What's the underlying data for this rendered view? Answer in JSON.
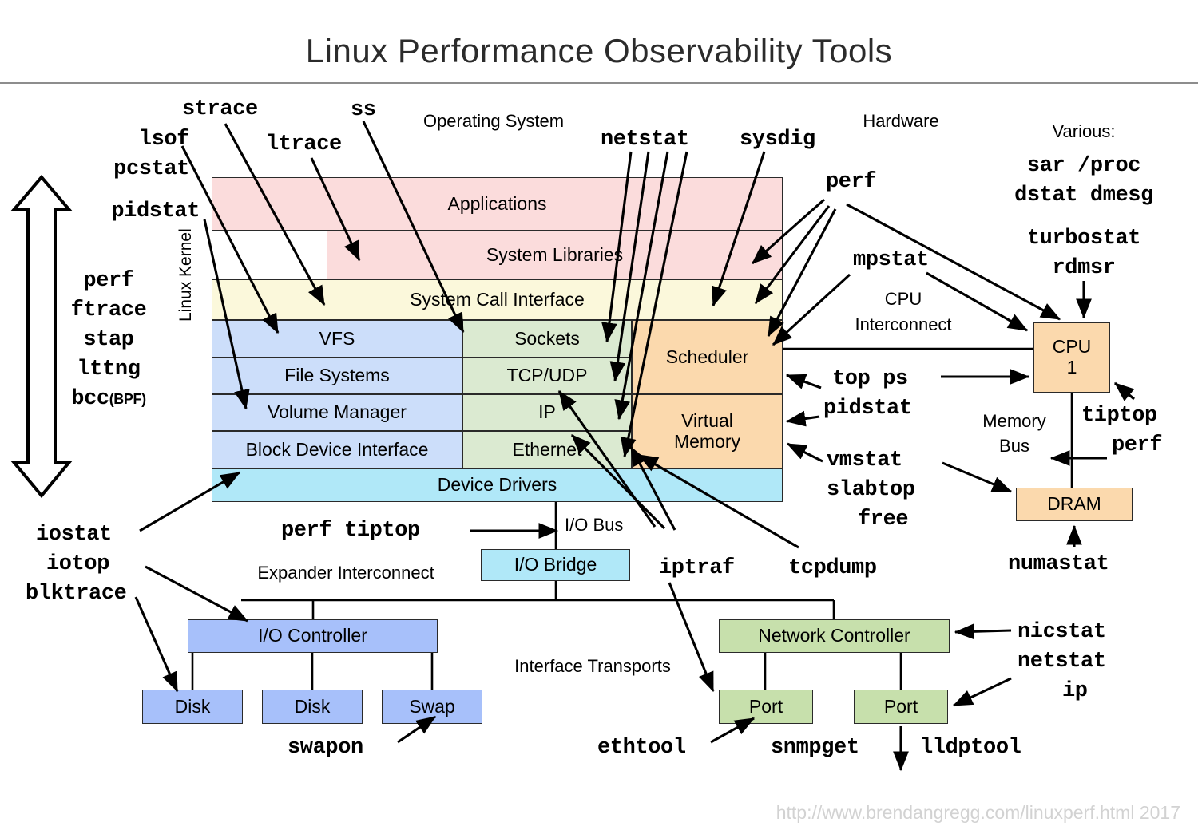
{
  "title": "Linux Performance Observability Tools",
  "footer": "http://www.brendangregg.com/linuxperf.html 2017",
  "section_labels": {
    "operating_system": "Operating System",
    "hardware": "Hardware",
    "various": "Various:",
    "linux_kernel": "Linux Kernel",
    "cpu_interconnect_l1": "CPU",
    "cpu_interconnect_l2": "Interconnect",
    "memory_bus_l1": "Memory",
    "memory_bus_l2": "Bus",
    "io_bus": "I/O Bus",
    "expander_interconnect": "Expander Interconnect",
    "interface_transports": "Interface Transports"
  },
  "stack": {
    "applications": "Applications",
    "system_libraries": "System Libraries",
    "system_call_interface": "System Call Interface",
    "vfs": "VFS",
    "file_systems": "File Systems",
    "volume_manager": "Volume Manager",
    "block_device_interface": "Block Device Interface",
    "sockets": "Sockets",
    "tcp_udp": "TCP/UDP",
    "ip": "IP",
    "ethernet": "Ethernet",
    "scheduler": "Scheduler",
    "virtual_memory_l1": "Virtual",
    "virtual_memory_l2": "Memory",
    "device_drivers": "Device Drivers"
  },
  "hardware": {
    "cpu_l1": "CPU",
    "cpu_l2": "1",
    "dram": "DRAM",
    "io_bridge": "I/O Bridge",
    "io_controller": "I/O Controller",
    "disk_1": "Disk",
    "disk_2": "Disk",
    "swap": "Swap",
    "network_controller": "Network Controller",
    "port_1": "Port",
    "port_2": "Port"
  },
  "tools": {
    "lsof": "lsof",
    "pcstat": "pcstat",
    "pidstat_left": "pidstat",
    "strace": "strace",
    "ltrace": "ltrace",
    "ss": "ss",
    "netstat_top": "netstat",
    "sysdig": "sysdig",
    "perf_hw": "perf",
    "mpstat": "mpstat",
    "sar_proc": "sar /proc",
    "dstat_dmesg": "dstat dmesg",
    "turbostat": "turbostat",
    "rdmsr": "rdmsr",
    "top_ps": "top ps",
    "pidstat_cpu": "pidstat",
    "tiptop": "tiptop",
    "perf_mem": "perf",
    "vmstat": "vmstat",
    "slabtop": "slabtop",
    "free": "free",
    "numastat": "numastat",
    "perf_stack": "perf",
    "ftrace": "ftrace",
    "stap": "stap",
    "lttng": "lttng",
    "bcc": "bcc",
    "bcc_suffix": "(BPF)",
    "iostat": "iostat",
    "iotop": "iotop",
    "blktrace": "blktrace",
    "perf_tiptop": "perf tiptop",
    "swapon": "swapon",
    "iptraf": "iptraf",
    "tcpdump": "tcpdump",
    "nicstat": "nicstat",
    "netstat_nic": "netstat",
    "ip": "ip",
    "ethtool": "ethtool",
    "snmpget": "snmpget",
    "lldptool": "lldptool"
  },
  "colors": {
    "pink": "#fbdcdc",
    "yellow": "#fbf8db",
    "blue": "#ccdefa",
    "green": "#dbead1",
    "orange": "#fbd9ad",
    "cyan": "#b0e8f8",
    "disk_blue": "#a7c0fa",
    "net_green": "#c7e0ac",
    "stroke": "#2a2a2a"
  }
}
